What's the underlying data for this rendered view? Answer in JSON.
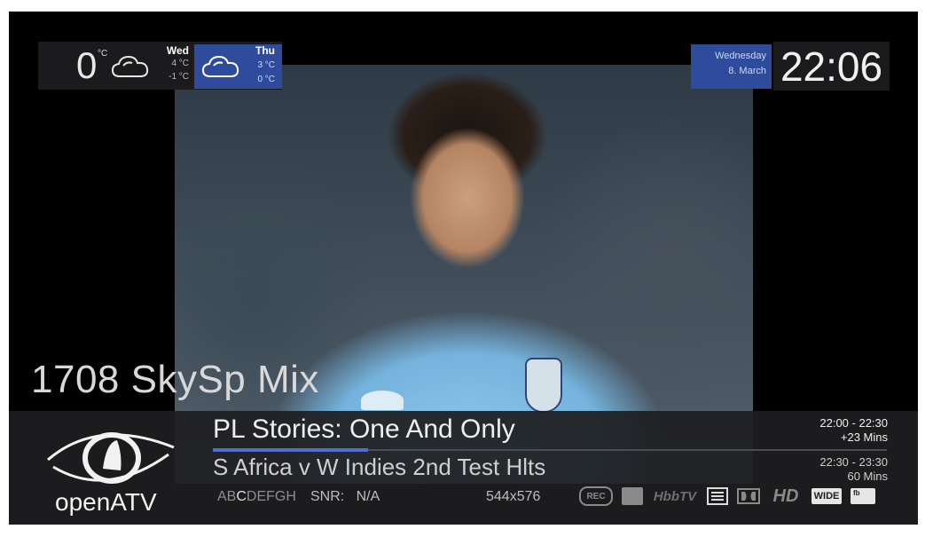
{
  "weather": {
    "current_temp": "0",
    "current_unit": "°C",
    "current_icon": "cloud-icon",
    "today": {
      "day": "Wed",
      "high": "4 °C",
      "low": "-1 °C"
    },
    "tomorrow": {
      "day": "Thu",
      "high": "3 °C",
      "low": "0 °C",
      "icon": "cloud-icon"
    }
  },
  "date": {
    "weekday": "Wednesday",
    "day_month": "8. March"
  },
  "clock": {
    "time": "22:06"
  },
  "channel": {
    "name": "1708 SkySp Mix"
  },
  "epg": {
    "now": {
      "title": "PL Stories: One And Only",
      "time": "22:00  -  22:30",
      "remaining": "+23 Mins",
      "progress": 0.23
    },
    "next": {
      "title": "S Africa v W Indies 2nd Test Hlts",
      "time": "22:30  -  23:30",
      "duration": "60 Mins"
    }
  },
  "logo": {
    "text": "openATV"
  },
  "status": {
    "caids": [
      {
        "t": "AB",
        "active": false
      },
      {
        "t": "C",
        "active": true
      },
      {
        "t": "DEFGH",
        "active": false
      }
    ],
    "snr_label": "SNR:",
    "snr_value": "N/A",
    "resolution": "544x576",
    "icons": {
      "rec": "REC",
      "hbbtv": "HbbTV",
      "hd": "HD",
      "wide": "WIDE",
      "fb": "fb"
    }
  },
  "colors": {
    "accent_blue": "#2f4c9c",
    "progress": "#4f6fc8",
    "bar_bg": "#1e1e20"
  }
}
